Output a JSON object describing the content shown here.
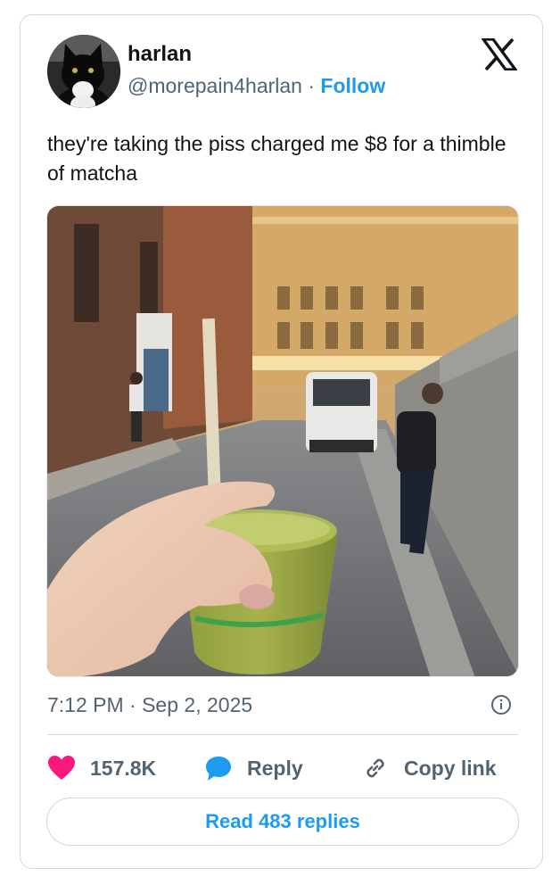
{
  "author": {
    "name": "harlan",
    "handle": "@morepain4harlan",
    "separator": " · ",
    "follow_label": "Follow"
  },
  "tweet": {
    "text": "they're taking the piss charged me $8 for a thimble of matcha",
    "timestamp": "7:12 PM · Sep 2, 2025"
  },
  "actions": {
    "like_count": "157.8K",
    "reply_label": "Reply",
    "copy_link_label": "Copy link",
    "read_replies_label": "Read 483 replies"
  },
  "icons": {
    "brand": "x-logo-icon",
    "like": "heart-icon",
    "reply": "speech-bubble-icon",
    "copy": "link-icon",
    "info": "info-icon"
  },
  "colors": {
    "accent": "#1d9bf0",
    "like": "#f91880",
    "text": "#0f1419",
    "muted": "#536471",
    "border": "#cfd9de"
  }
}
